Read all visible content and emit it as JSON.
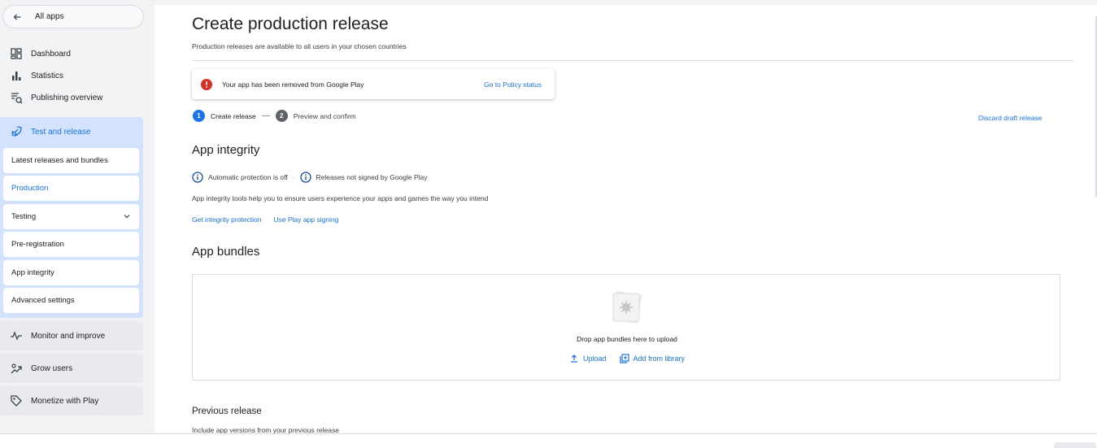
{
  "sidebar": {
    "all_apps": "All apps",
    "top_items": [
      {
        "label": "Dashboard",
        "icon": "dashboard-icon"
      },
      {
        "label": "Statistics",
        "icon": "bar-chart-icon"
      },
      {
        "label": "Publishing overview",
        "icon": "publishing-overview-icon"
      }
    ],
    "test_release": {
      "label": "Test and release",
      "icon": "rocket-icon",
      "items": [
        {
          "label": "Latest releases and bundles"
        },
        {
          "label": "Production"
        },
        {
          "label": "Testing"
        },
        {
          "label": "Pre-registration"
        },
        {
          "label": "App integrity"
        },
        {
          "label": "Advanced settings"
        }
      ]
    },
    "sections": [
      {
        "label": "Monitor and improve",
        "icon": "monitor-icon"
      },
      {
        "label": "Grow users",
        "icon": "grow-icon"
      },
      {
        "label": "Monetize with Play",
        "icon": "tag-icon"
      }
    ]
  },
  "main": {
    "title": "Create production release",
    "subtitle": "Production releases are available to all users in your chosen countries",
    "alert": {
      "message": "Your app has been removed from Google Play",
      "link": "Go to Policy status"
    },
    "steps": [
      {
        "num": "1",
        "label": "Create release"
      },
      {
        "num": "2",
        "label": "Preview and confirm"
      }
    ],
    "discard": "Discard draft release",
    "integrity": {
      "heading": "App integrity",
      "status1": "Automatic protection is off",
      "status2": "Releases not signed by Google Play",
      "description": "App integrity tools help you to ensure users experience your apps and games the way you intend",
      "link1": "Get integrity protection",
      "link2": "Use Play app signing"
    },
    "bundles": {
      "heading": "App bundles",
      "drop_text": "Drop app bundles here to upload",
      "upload": "Upload",
      "library": "Add from library"
    },
    "previous": {
      "heading": "Previous release",
      "description": "Include app versions from your previous release"
    }
  },
  "colors": {
    "accent": "#1a73e8",
    "error": "#d93025",
    "active_nav": "#d3e3fd"
  }
}
